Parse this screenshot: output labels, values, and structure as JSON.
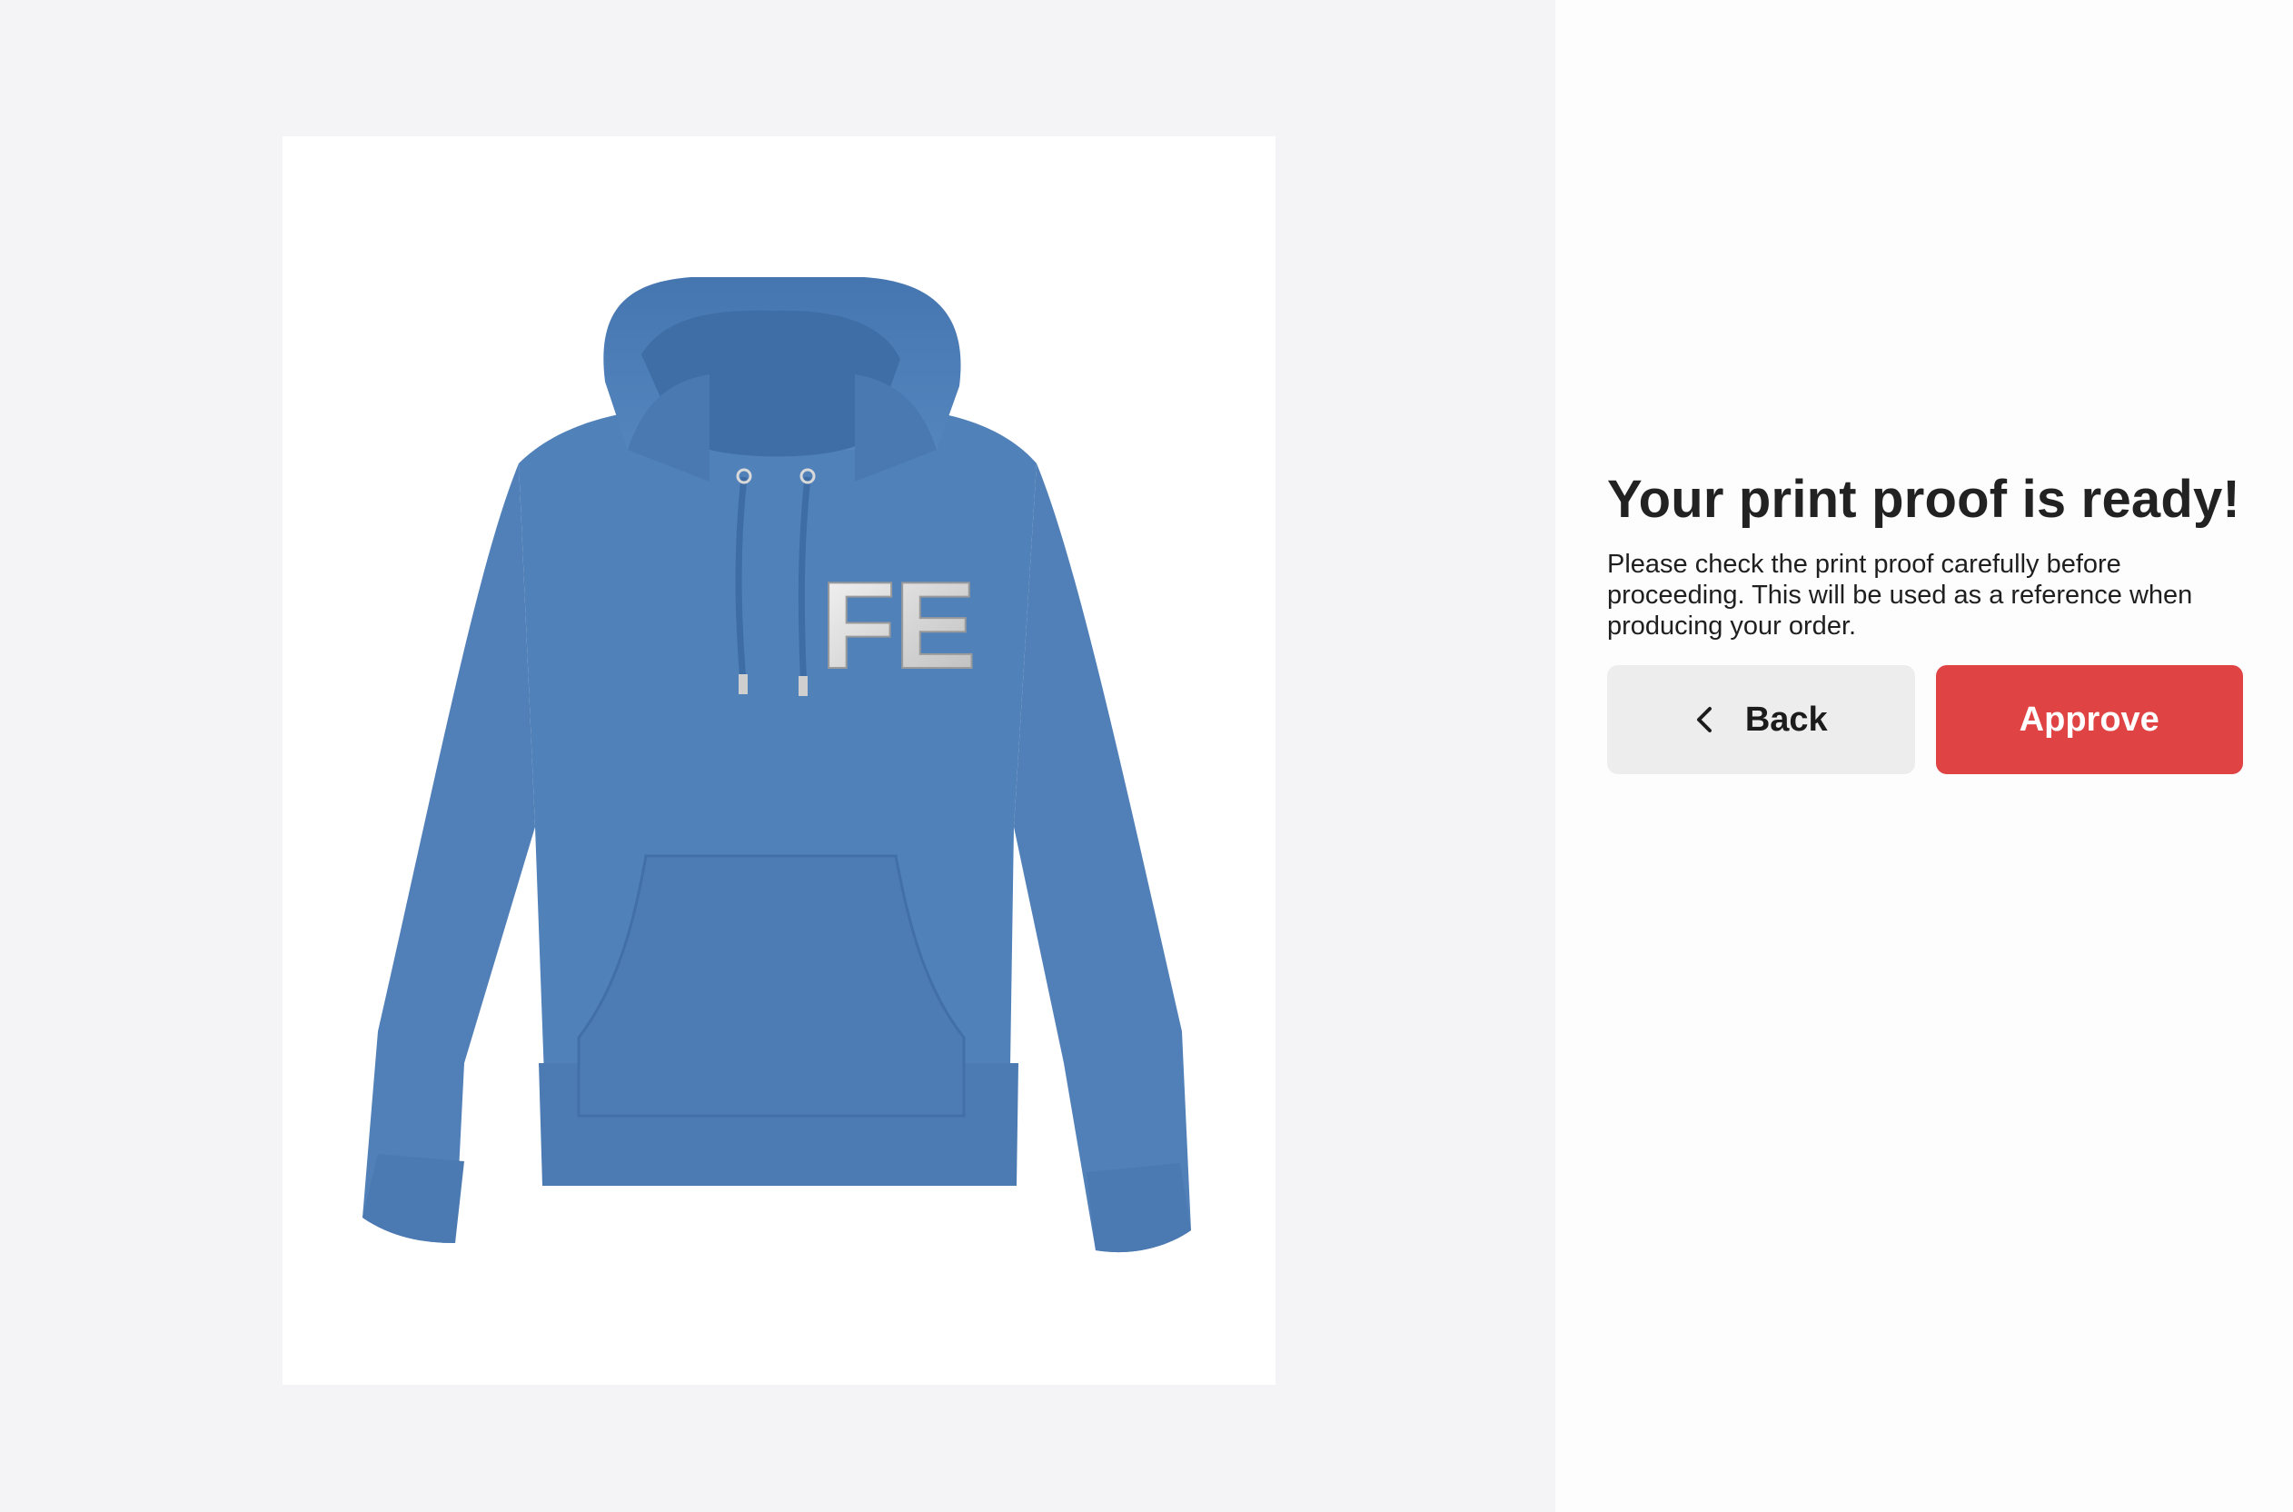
{
  "proof": {
    "garment": "hoodie",
    "garment_color": "#4f7fb7",
    "print_text": "FE",
    "print_color": "#e9e9e9"
  },
  "panel": {
    "title": "Your print proof is ready!",
    "description": "Please check the print proof carefully before proceeding. This will be used as a reference when producing your order.",
    "back_label": "Back",
    "back_icon": "chevron-left-icon",
    "approve_label": "Approve",
    "approve_color": "#e04343"
  }
}
